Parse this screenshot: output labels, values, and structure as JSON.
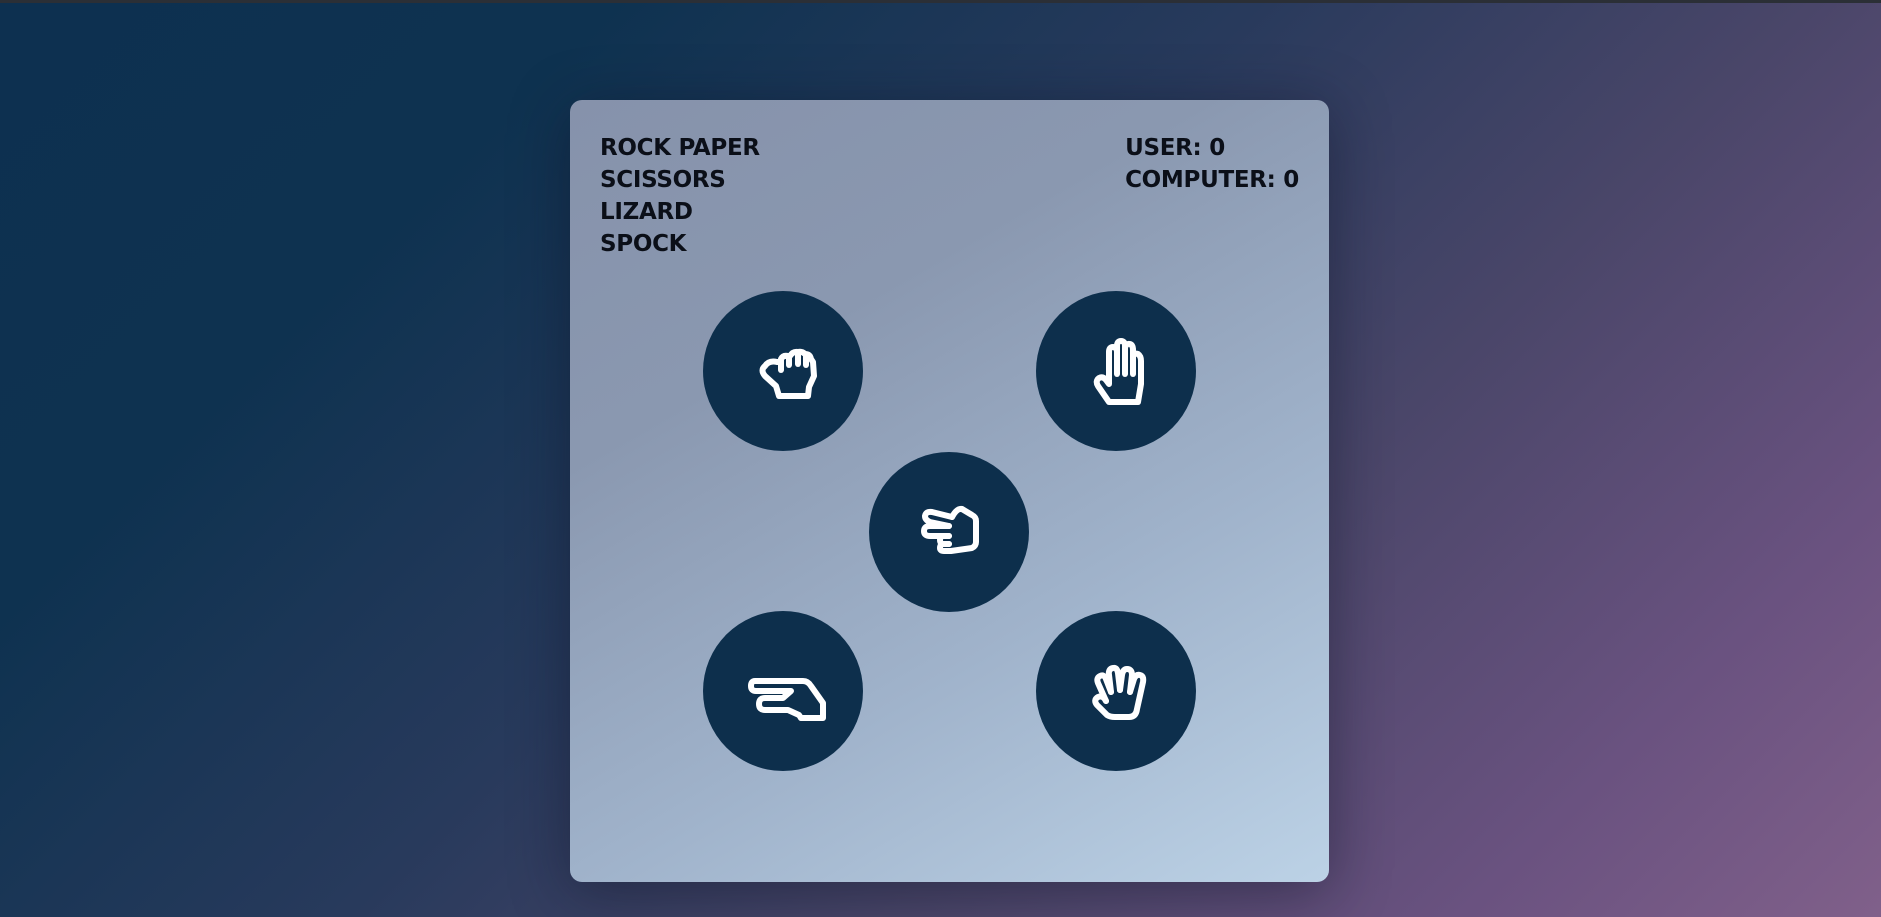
{
  "game": {
    "title_lines": [
      "ROCK PAPER",
      "SCISSORS",
      "LIZARD",
      "SPOCK"
    ],
    "score": {
      "user_label": "USER:",
      "user_value": "0",
      "computer_label": "COMPUTER:",
      "computer_value": "0"
    },
    "choices": [
      {
        "name": "rock",
        "icon": "hand-rock-icon"
      },
      {
        "name": "paper",
        "icon": "hand-paper-icon"
      },
      {
        "name": "scissors",
        "icon": "hand-scissors-icon"
      },
      {
        "name": "lizard",
        "icon": "hand-lizard-icon"
      },
      {
        "name": "spock",
        "icon": "hand-spock-icon"
      }
    ]
  },
  "colors": {
    "circle": "#0d2f4c",
    "icon": "#ffffff",
    "text": "#0b0f18"
  }
}
